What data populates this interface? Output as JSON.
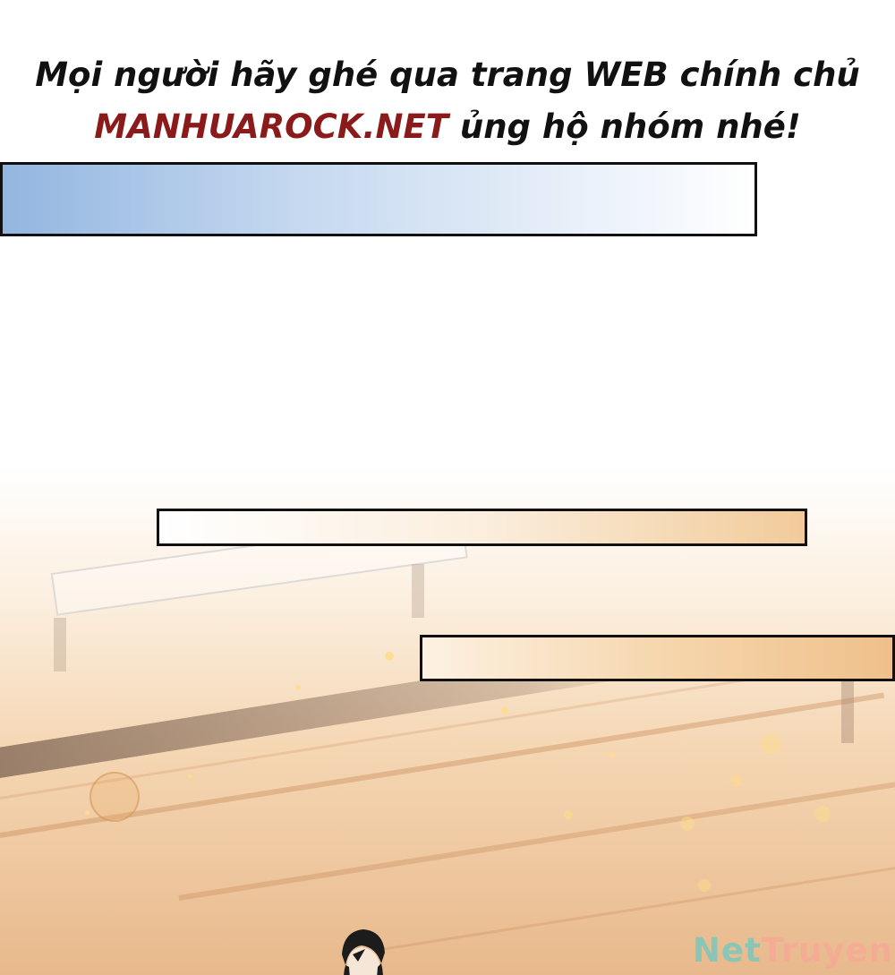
{
  "notice": {
    "line1": "Mọi người hãy ghé qua trang WEB chính chủ",
    "brand": "MANHUAROCK.NET",
    "line2_rest": " ủng hộ nhóm nhé!",
    "text_color": "#111111",
    "brand_color": "#8b1a1a"
  },
  "panels": {
    "box_1_colors": [
      "#93b6e0",
      "#ffffff"
    ],
    "box_2_colors": [
      "#ffffff",
      "#f1cb9a"
    ],
    "box_3_colors": [
      "#fdf1e2",
      "#efc08a"
    ]
  },
  "watermark": {
    "part1": "Net",
    "part2": "Truyen"
  }
}
